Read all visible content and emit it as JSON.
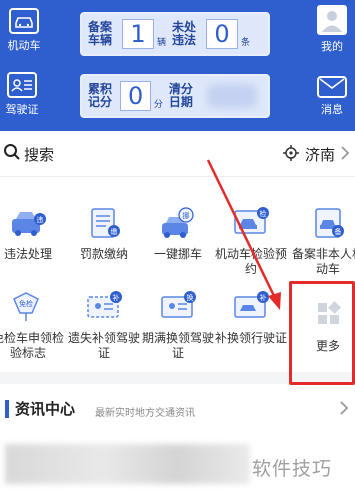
{
  "header": {
    "left_top_label": "机动车",
    "left_bottom_label": "驾驶证",
    "right_top_label": "我的",
    "right_bottom_label": "消息",
    "card1": {
      "label_a": "备案车辆",
      "value_a": "1",
      "unit_a": "辆",
      "label_b": "未处违法",
      "value_b": "0",
      "unit_b": "条"
    },
    "card2": {
      "label_a": "累积记分",
      "value_a": "0",
      "unit_a": "分",
      "label_b": "清分日期",
      "value_b": ""
    }
  },
  "search": {
    "label": "搜索",
    "location": "济南"
  },
  "services": [
    {
      "label": "违法处理",
      "icon": "violation-car-icon"
    },
    {
      "label": "罚款缴纳",
      "icon": "fine-document-icon"
    },
    {
      "label": "一键挪车",
      "icon": "move-car-icon"
    },
    {
      "label": "机动车检验预约",
      "icon": "inspection-appointment-icon"
    },
    {
      "label": "备案非本人机动车",
      "icon": "register-vehicle-icon"
    },
    {
      "label": "免检车申领检验标志",
      "icon": "exempt-inspection-label-icon"
    },
    {
      "label": "遗失补领驾驶证",
      "icon": "lost-license-replace-icon"
    },
    {
      "label": "期满换领驾驶证",
      "icon": "expired-license-renew-icon"
    },
    {
      "label": "补换领行驶证",
      "icon": "vehicle-license-replace-icon"
    },
    {
      "label": "更多",
      "icon": "more-grid-icon"
    }
  ],
  "news": {
    "title": "资讯中心",
    "subtitle": "最新实时地方交通资讯",
    "watermark": "软件技巧"
  },
  "colors": {
    "brand": "#2f5fcf",
    "annotation": "#e52a2a"
  }
}
